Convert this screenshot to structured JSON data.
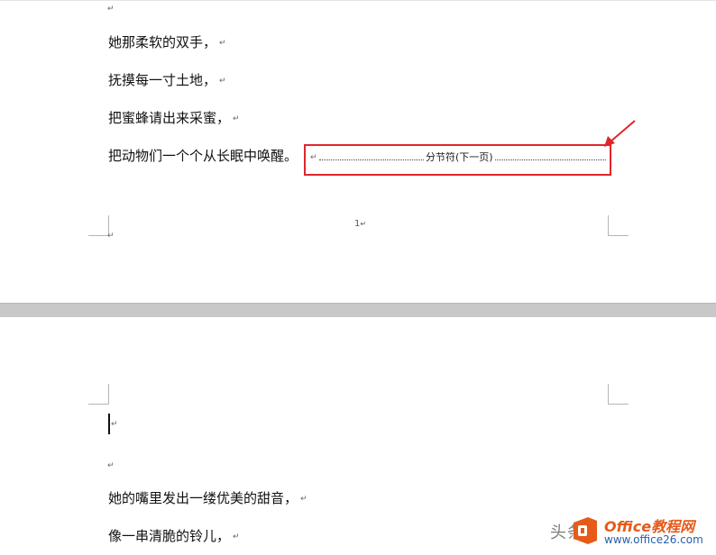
{
  "page1": {
    "lines": [
      "她那柔软的双手，",
      "抚摸每一寸土地，",
      "把蜜蜂请出来采蜜，",
      "把动物们一个个从长眠中唤醒。"
    ],
    "section_break_label": "分节符(下一页)",
    "page_number": "1"
  },
  "page2": {
    "lines": [
      "她的嘴里发出一缕优美的甜音，",
      "像一串清脆的铃儿，"
    ]
  },
  "marks": {
    "paragraph": "↵"
  },
  "watermark": {
    "text": "头条",
    "brand": "Office教程网",
    "url": "www.office26.com"
  },
  "colors": {
    "highlight": "#e0262a",
    "page_gap": "#c8c8c8",
    "brand_orange": "#e65a1a"
  }
}
